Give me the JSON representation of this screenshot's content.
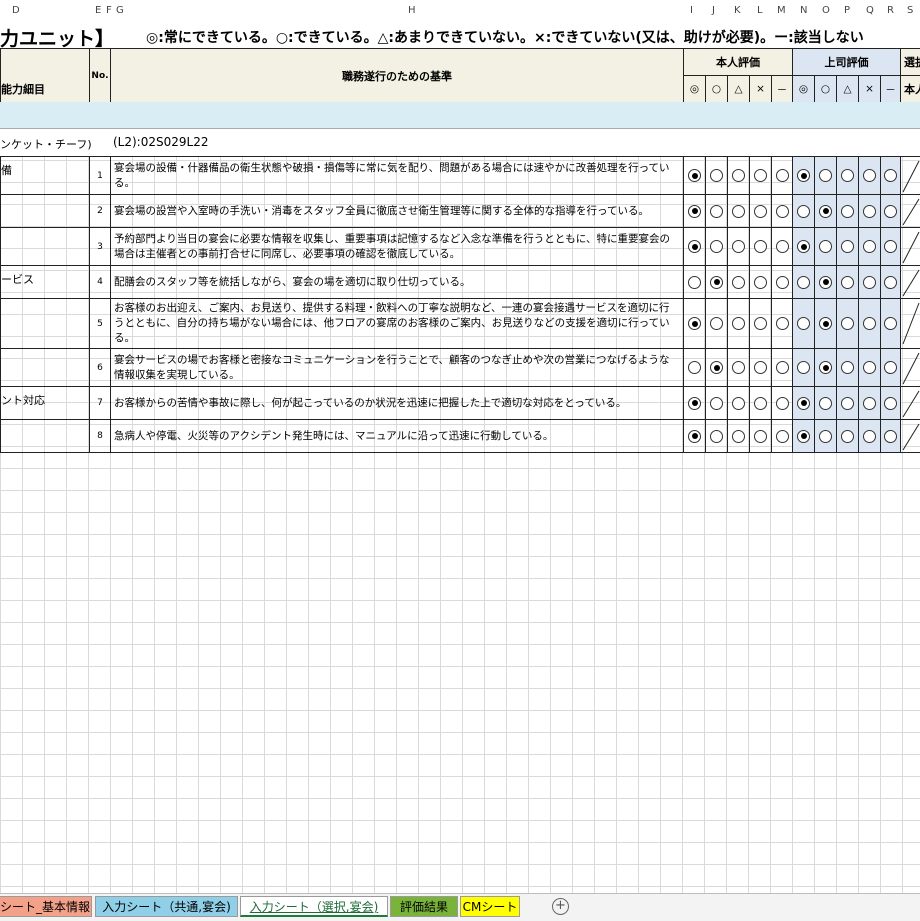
{
  "column_headers": [
    "D",
    "E",
    "F",
    "G",
    "H",
    "I",
    "J",
    "K",
    "L",
    "M",
    "N",
    "O",
    "P",
    "Q",
    "R",
    "S"
  ],
  "title": {
    "unit": "力ユニット】",
    "legend": "◎:常にできている。○:できている。△:あまりできていない。×:できていない(又は、助けが必要)。ー:該当しない"
  },
  "header": {
    "col_d": "能力細目",
    "col_no": "No.",
    "col_h": "職務遂行のための基準",
    "self_eval": "本人評価",
    "boss_eval": "上司評価",
    "extra": "選択",
    "extra2": "本人",
    "grade_marks": [
      "◎",
      "○",
      "△",
      "×",
      "－"
    ]
  },
  "section": {
    "left": "ンケット・チーフ)",
    "code": "(L2):02S029L22"
  },
  "rows": [
    {
      "category": "備",
      "no": "1",
      "text": "宴会場の設備・什器備品の衛生状態や破損・損傷等に常に気を配り、問題がある場合には速やかに改善処理を行っている。",
      "self": 0,
      "boss": 0
    },
    {
      "category": "",
      "no": "2",
      "text": "宴会場の設営や入室時の手洗い・消毒をスタッフ全員に徹底させ衛生管理等に関する全体的な指導を行っている。",
      "self": 0,
      "boss": 1
    },
    {
      "category": "",
      "no": "3",
      "text": "予約部門より当日の宴会に必要な情報を収集し、重要事項は記憶するなど入念な準備を行うとともに、特に重要宴会の場合は主催者との事前打合せに同席し、必要事項の確認を徹底している。",
      "self": 0,
      "boss": 0
    },
    {
      "category": "ービス",
      "no": "4",
      "text": "配膳会のスタッフ等を統括しながら、宴会の場を適切に取り仕切っている。",
      "self": 1,
      "boss": 1
    },
    {
      "category": "",
      "no": "5",
      "text": "お客様のお出迎え、ご案内、お見送り、提供する料理・飲料への丁寧な説明など、一連の宴会接遇サービスを適切に行うとともに、自分の持ち場がない場合には、他フロアの宴席のお客様のご案内、お見送りなどの支援を適切に行っている。",
      "self": 0,
      "boss": 1
    },
    {
      "category": "",
      "no": "6",
      "text": "宴会サービスの場でお客様と密接なコミュニケーションを行うことで、顧客のつなぎ止めや次の営業につなげるような情報収集を実現している。",
      "self": 1,
      "boss": 1
    },
    {
      "category": "ント対応",
      "no": "7",
      "text": "お客様からの苦情や事故に際し、何が起こっているのか状況を迅速に把握した上で適切な対応をとっている。",
      "self": 0,
      "boss": 0
    },
    {
      "category": "",
      "no": "8",
      "text": "急病人や停電、火災等のアクシデント発生時には、マニュアルに沿って迅速に行動している。",
      "self": 0,
      "boss": 0
    }
  ],
  "tabs": [
    {
      "label": "シート_基本情報",
      "color": "#f4a18a"
    },
    {
      "label": "入力シート（共通,宴会)",
      "color": "#8fd0e8"
    },
    {
      "label": "入力シート（選択,宴会)",
      "color": "#ffffff"
    },
    {
      "label": "評価結果",
      "color": "#79b33a"
    },
    {
      "label": "CMシート",
      "color": "#ffff00"
    }
  ],
  "add_sheet_icon": "plus-circle-icon"
}
